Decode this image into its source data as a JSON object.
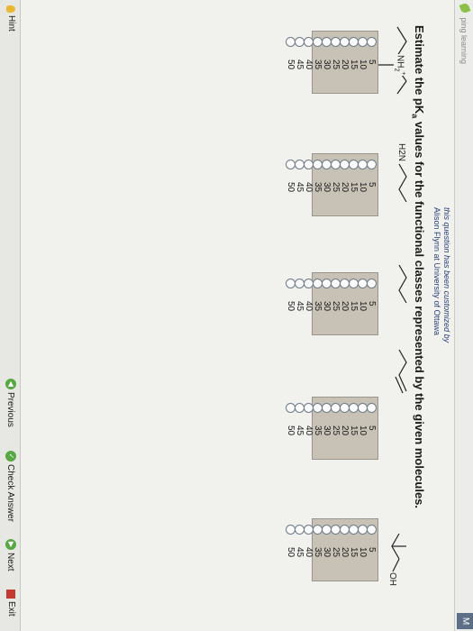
{
  "header": {
    "logo_text": "ping learning",
    "m_label": "M"
  },
  "customization": {
    "line1": "this question has been customized by",
    "line2": "Alison Flynn at University of Ottawa"
  },
  "question": {
    "prefix": "Estimate the pK",
    "subscript": "a",
    "suffix": " values for the functional classes represented by the given molecules."
  },
  "molecules": [
    {
      "id": "ammonium",
      "atom_label": "NH2+"
    },
    {
      "id": "amine",
      "atom_label": "H2N"
    },
    {
      "id": "alkane",
      "atom_label": ""
    },
    {
      "id": "alkene",
      "atom_label": ""
    },
    {
      "id": "alcohol",
      "atom_label": "OH"
    }
  ],
  "options": [
    "5",
    "10",
    "15",
    "20",
    "25",
    "30",
    "35",
    "40",
    "45",
    "50"
  ],
  "footer": {
    "hint": "Hint",
    "previous": "Previous",
    "check": "Check Answer",
    "next": "Next",
    "exit": "Exit"
  }
}
